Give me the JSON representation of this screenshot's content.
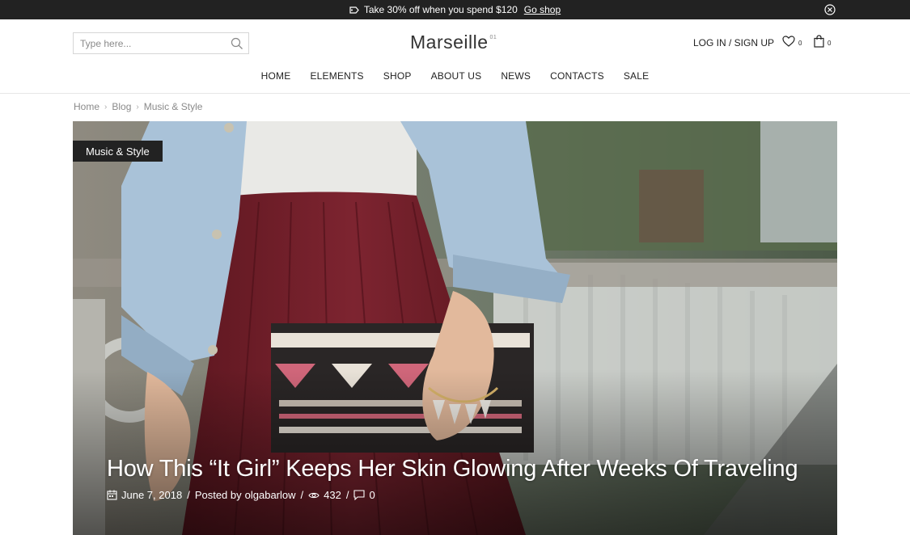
{
  "promo": {
    "text": "Take 30% off when you spend $120",
    "link": "Go shop"
  },
  "header": {
    "search_placeholder": "Type here...",
    "logo": "Marseille",
    "logo_sup": "01",
    "account": "LOG IN / SIGN UP",
    "wishlist_count": "0",
    "cart_count": "0"
  },
  "nav": [
    "HOME",
    "ELEMENTS",
    "SHOP",
    "ABOUT US",
    "NEWS",
    "CONTACTS",
    "SALE"
  ],
  "breadcrumb": [
    "Home",
    "Blog",
    "Music & Style"
  ],
  "post": {
    "category": "Music & Style",
    "title": "How This “It Girl” Keeps Her Skin Glowing After Weeks Of Traveling",
    "date": "June 7, 2018",
    "posted_by": "Posted by",
    "author": "olgabarlow",
    "views": "432",
    "comments": "0"
  },
  "colors": {
    "topbar": "#222222",
    "badge": "#222222",
    "skirt": "#7a1f27",
    "denim": "#a9c2d8"
  }
}
